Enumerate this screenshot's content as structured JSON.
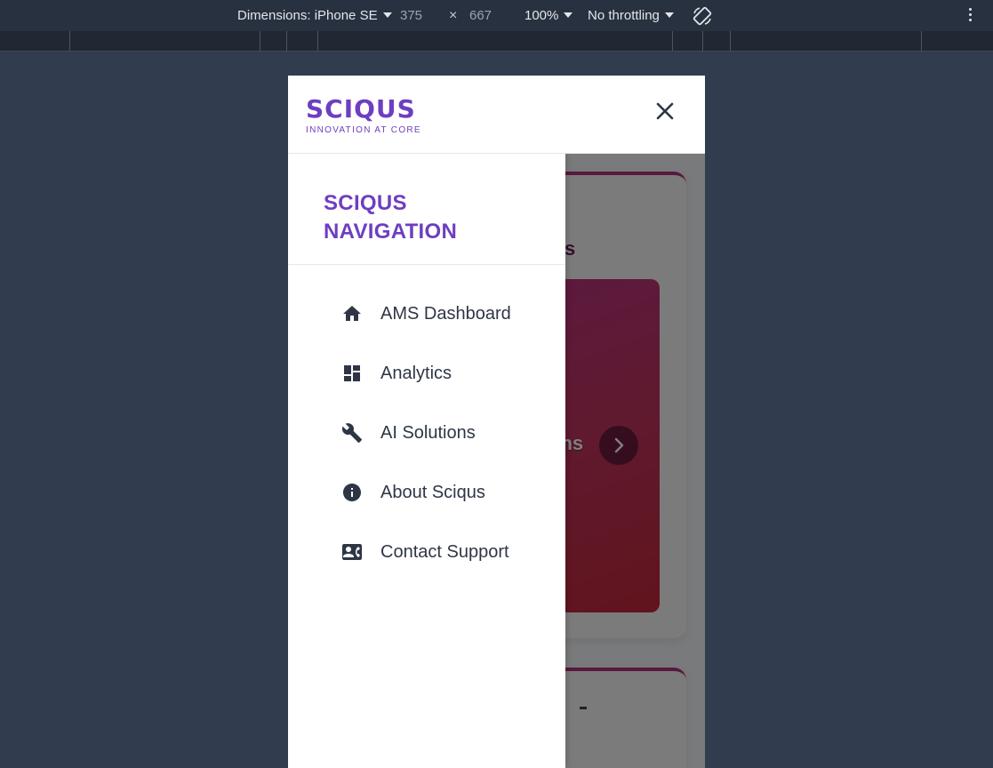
{
  "devtools": {
    "dimensions_label": "Dimensions: iPhone SE",
    "width_value": "375",
    "times_symbol": "×",
    "height_value": "667",
    "zoom": "100%",
    "throttling": "No throttling"
  },
  "header": {
    "logo_text": "SCIQUS",
    "tagline": "INNOVATION AT CORE",
    "close_icon": "close-icon"
  },
  "drawer": {
    "title": "SCIQUS NAVIGATION",
    "items": [
      {
        "label": "AMS Dashboard",
        "icon": "home-icon"
      },
      {
        "label": "Analytics",
        "icon": "dashboard-icon"
      },
      {
        "label": "AI Solutions",
        "icon": "wrench-icon"
      },
      {
        "label": "About Sciqus",
        "icon": "info-icon"
      },
      {
        "label": "Contact Support",
        "icon": "contact-card-icon"
      }
    ]
  },
  "background": {
    "card_title_fragment": "s",
    "panel_text_fragment": "ons"
  },
  "colors": {
    "brand": "#6d3fc0",
    "text": "#2e3646",
    "card_accent": "#b2307a"
  }
}
